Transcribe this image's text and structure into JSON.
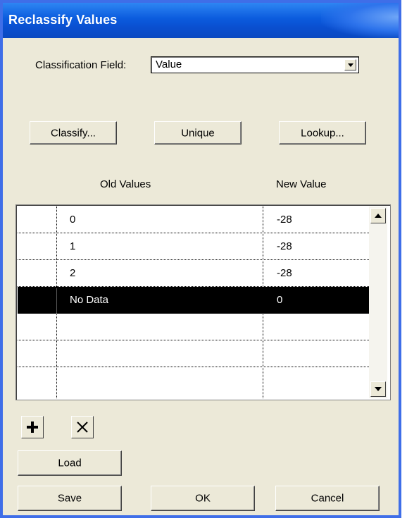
{
  "window": {
    "title": "Reclassify Values"
  },
  "classification": {
    "label": "Classification Field:",
    "value": "Value"
  },
  "buttons": {
    "classify": "Classify...",
    "unique": "Unique",
    "lookup": "Lookup...",
    "load": "Load",
    "save": "Save",
    "ok": "OK",
    "cancel": "Cancel"
  },
  "table": {
    "headers": {
      "old": "Old Values",
      "new": "New Value"
    },
    "rows": [
      {
        "old": "0",
        "new": "-28"
      },
      {
        "old": "1",
        "new": "-28"
      },
      {
        "old": "2",
        "new": "-28"
      },
      {
        "old": "No Data",
        "new": "0"
      }
    ],
    "selected_row": 3
  },
  "icons": {
    "add": "plus-icon",
    "delete": "x-icon",
    "scroll_up": "arrow-up-icon",
    "scroll_down": "arrow-down-icon",
    "dropdown": "chevron-down-icon"
  },
  "colors": {
    "title_bar": "#0a4fd0",
    "frame": "#3f6ee8",
    "dialog_face": "#ece9d8",
    "selection": "#000000"
  }
}
